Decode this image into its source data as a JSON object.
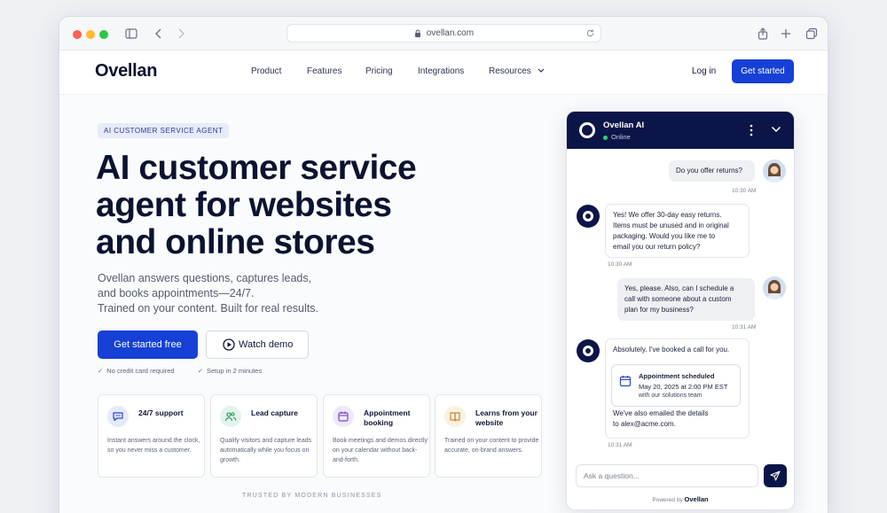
{
  "browser": {
    "url": "ovellan.com"
  },
  "nav": {
    "logo": "Ovellan",
    "links": [
      "Product",
      "Features",
      "Pricing",
      "Integrations",
      "Resources"
    ],
    "login": "Log in",
    "cta": "Get started"
  },
  "hero": {
    "badge": "AI CUSTOMER SERVICE AGENT",
    "headline_lines": [
      "AI customer service",
      "agent for websites",
      "and online stores"
    ],
    "sub_lines": [
      "Ovellan answers questions, captures leads,",
      "and books appointments—24/7.",
      "Trained on your content. Built for real results."
    ],
    "primary_button": "Get started free",
    "secondary_button": "Watch demo",
    "checks": [
      "No credit card required",
      "Setup in 2 minutes"
    ]
  },
  "features": [
    {
      "title": "24/7 support",
      "desc": "Instant answers around the clock, so you never miss a customer.",
      "icon": "chat-icon",
      "color": "#e6ebfb"
    },
    {
      "title": "Lead capture",
      "desc": "Qualify visitors and capture leads automatically while you focus on growth.",
      "icon": "users-icon",
      "color": "#e3f4ec"
    },
    {
      "title": "Appointment booking",
      "desc": "Book meetings and demos directly on your calendar without back-and-forth.",
      "icon": "calendar-icon",
      "color": "#efe8fa"
    },
    {
      "title": "Learns from your website",
      "desc": "Trained on your content to provide accurate, on-brand answers.",
      "icon": "book-icon",
      "color": "#fbf1e2"
    }
  ],
  "trusted": "TRUSTED BY MODERN BUSINESSES",
  "chat": {
    "name": "Ovellan AI",
    "status": "Online",
    "messages": [
      {
        "from": "user",
        "text": "Do you offer returns?",
        "time": "10:30 AM"
      },
      {
        "from": "bot",
        "lines": [
          "Yes! We offer 30-day easy returns.",
          "Items must be unused and in original",
          "packaging. Would you like me to",
          "email you our return policy?"
        ],
        "time": "10:30 AM"
      },
      {
        "from": "user",
        "lines": [
          "Yes, please. Also, can I schedule a",
          "call with someone about a custom",
          "plan for my business?"
        ],
        "time": "10:31 AM"
      },
      {
        "from": "bot",
        "intro": "Absolutely. I've booked a call for you.",
        "outro_lines": [
          "We've also emailed the details",
          "to alex@acme.com."
        ],
        "time": "10:31 AM"
      }
    ],
    "appointment": {
      "title": "Appointment scheduled",
      "datetime": "May 20, 2025 at 2:00 PM EST",
      "with": "with our solutions team"
    },
    "input_placeholder": "Ask a question...",
    "powered_prefix": "Powered by",
    "powered_brand": "Ovellan"
  }
}
